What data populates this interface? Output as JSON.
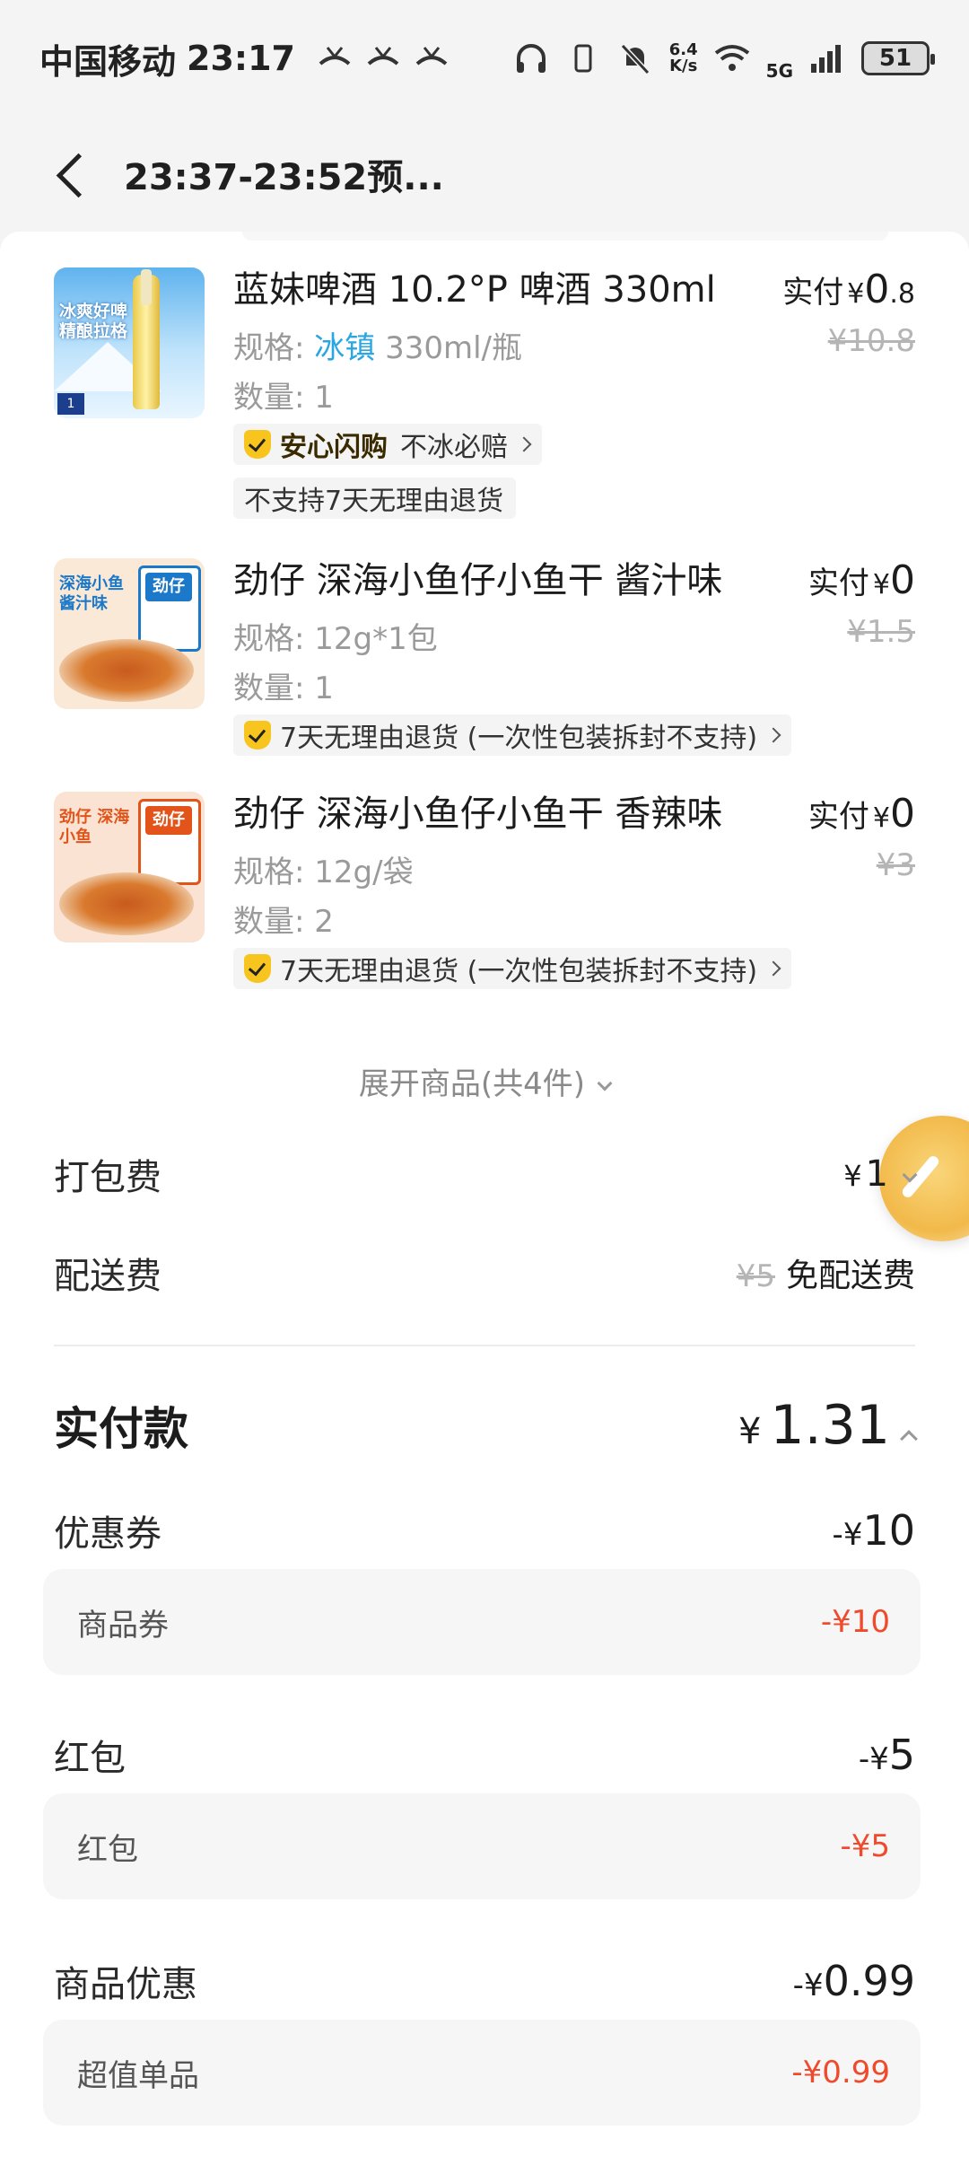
{
  "status_bar": {
    "carrier": "中国移动",
    "time": "23:17",
    "net_speed_value": "6.4",
    "net_speed_unit": "K/s",
    "network": "5G",
    "battery": "51"
  },
  "header": {
    "title": "23:37-23:52预..."
  },
  "products": [
    {
      "name": "蓝妹啤酒 10.2°P 啤酒 330ml",
      "paid_label": "实付",
      "paid_int": "0",
      "paid_dec": ".8",
      "original_price": "¥10.8",
      "spec_label": "规格: ",
      "spec_highlight": "冰镇",
      "spec_rest": " 330ml/瓶",
      "qty": "数量: 1",
      "thumb_text": "冰爽好啤 精酿拉格",
      "thumb_badge": "1",
      "tags": [
        {
          "strong": "安心闪购",
          "text": "不冰必赔"
        },
        {
          "text": "不支持7天无理由退货"
        }
      ]
    },
    {
      "name": "劲仔 深海小鱼仔小鱼干 酱汁味",
      "paid_label": "实付",
      "paid_int": "0",
      "paid_dec": "",
      "original_price": "¥1.5",
      "spec_label": "规格: ",
      "spec_highlight": "",
      "spec_rest": "12g*1包",
      "qty": "数量: 1",
      "thumb_text": "深海小鱼 酱汁味",
      "thumb_brand": "劲仔",
      "tags": [
        {
          "text": "7天无理由退货 (一次性包装拆封不支持)"
        }
      ]
    },
    {
      "name": "劲仔 深海小鱼仔小鱼干 香辣味",
      "paid_label": "实付",
      "paid_int": "0",
      "paid_dec": "",
      "original_price": "¥3",
      "spec_label": "规格: ",
      "spec_highlight": "",
      "spec_rest": "12g/袋",
      "qty": "数量: 2",
      "thumb_text": "劲仔 深海小鱼",
      "thumb_brand": "劲仔",
      "tags": [
        {
          "text": "7天无理由退货 (一次性包装拆封不支持)"
        }
      ]
    }
  ],
  "expand_label": "展开商品(共4件)",
  "fees": {
    "packing_label": "打包费",
    "packing_value": "1",
    "delivery_label": "配送费",
    "delivery_original": "¥5",
    "delivery_value": "免配送费"
  },
  "total": {
    "label": "实付款",
    "value": "1.31"
  },
  "discounts": {
    "coupon_label": "优惠券",
    "coupon_value": "10",
    "coupon_sub_label": "商品券",
    "coupon_sub_value": "-¥10",
    "redpacket_label": "红包",
    "redpacket_value": "5",
    "redpacket_sub_label": "红包",
    "redpacket_sub_value": "-¥5",
    "product_label": "商品优惠",
    "product_value": "0.99",
    "product_sub_label": "超值单品",
    "product_sub_value": "-¥0.99"
  },
  "currency": "¥",
  "neg_currency": "-¥",
  "colors": {
    "accent_red": "#ef4a2c",
    "spec_highlight": "#2aa6e0",
    "badge_yellow": "#f7c51d"
  }
}
